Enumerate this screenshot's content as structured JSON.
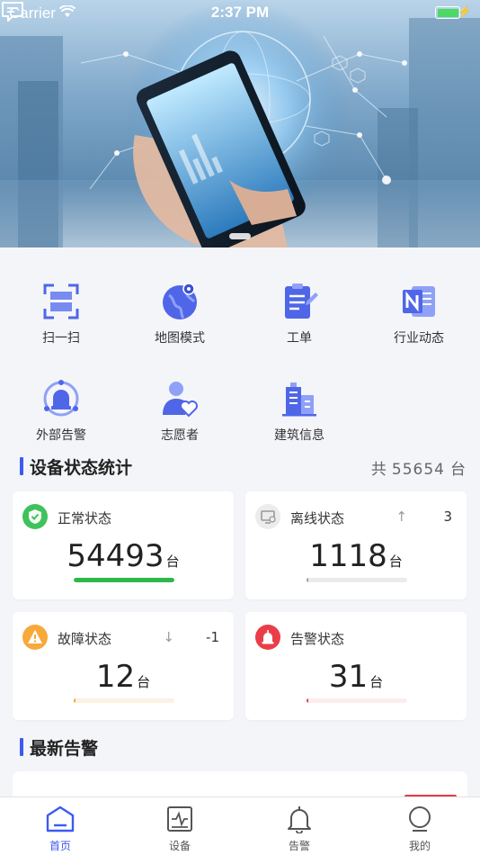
{
  "status_bar": {
    "carrier": "Carrier",
    "time": "2:37 PM"
  },
  "banner": {
    "image_desc_icon": "hero-banner"
  },
  "quick_actions": [
    {
      "label": "扫一扫",
      "icon": "scan-icon"
    },
    {
      "label": "地图模式",
      "icon": "map-globe-icon"
    },
    {
      "label": "工单",
      "icon": "work-order-icon"
    },
    {
      "label": "行业动态",
      "icon": "news-icon"
    },
    {
      "label": "外部告警",
      "icon": "external-alarm-icon"
    },
    {
      "label": "志愿者",
      "icon": "volunteer-icon"
    },
    {
      "label": "建筑信息",
      "icon": "building-icon"
    }
  ],
  "device_stats": {
    "title": "设备状态统计",
    "total_prefix": "共",
    "total": "55654",
    "total_unit": "台",
    "cards": [
      {
        "title": "正常状态",
        "value": "54493",
        "unit": "台",
        "trend": "",
        "delta": "",
        "bar_fraction": 1.0,
        "color": "#2eb84a",
        "track": "#e6f6ea"
      },
      {
        "title": "离线状态",
        "value": "1118",
        "unit": "台",
        "trend": "↑",
        "delta": "3",
        "bar_fraction": 0.02,
        "color": "#9a9a9a",
        "track": "#ebebeb"
      },
      {
        "title": "故障状态",
        "value": "12",
        "unit": "台",
        "trend": "↓",
        "delta": "-1",
        "bar_fraction": 0.0,
        "color": "#f5a623",
        "track": "#fdf1e4"
      },
      {
        "title": "告警状态",
        "value": "31",
        "unit": "台",
        "trend": "",
        "delta": "",
        "bar_fraction": 0.01,
        "color": "#e83b46",
        "track": "#fdecee"
      }
    ]
  },
  "latest_alerts": {
    "title": "最新告警"
  },
  "tabs": [
    {
      "label": "首页",
      "icon": "home-icon",
      "active": true
    },
    {
      "label": "设备",
      "icon": "device-monitor-icon",
      "active": false
    },
    {
      "label": "告警",
      "icon": "bell-icon",
      "active": false
    },
    {
      "label": "我的",
      "icon": "profile-icon",
      "active": false
    }
  ],
  "colors": {
    "accent": "#3d5af1",
    "background": "#f4f5f9"
  }
}
